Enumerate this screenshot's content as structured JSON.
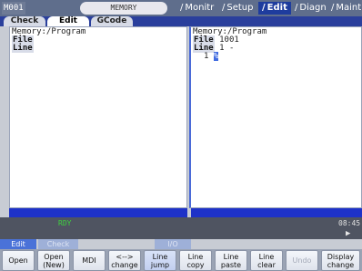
{
  "status": {
    "program": "M001",
    "mode": "MEMORY"
  },
  "top_menu": [
    "Monitr",
    "Setup",
    "Edit",
    "Diagn",
    "Maint"
  ],
  "tabs": [
    "Check",
    "Edit",
    "GCode"
  ],
  "left_pane": {
    "memory": "Memory:/Program",
    "file_label": "File",
    "line_label": "Line"
  },
  "right_pane": {
    "memory": "Memory:/Program",
    "file_label": "File",
    "file_value": "1001",
    "line_label": "Line",
    "line_value": "1 -",
    "line_num": "1",
    "cursor_char": "%"
  },
  "message": {
    "status": "RDY",
    "clock": "08:45",
    "arrow": "▶"
  },
  "mode_tabs": [
    "Edit",
    "Check",
    "I/O"
  ],
  "softkeys": [
    "Open",
    "Open\n(New)",
    "MDI",
    "<-->\nchange",
    "Line\njump",
    "Line\ncopy",
    "Line\npaste",
    "Line\nclear",
    "Undo",
    "Display\nchange"
  ]
}
